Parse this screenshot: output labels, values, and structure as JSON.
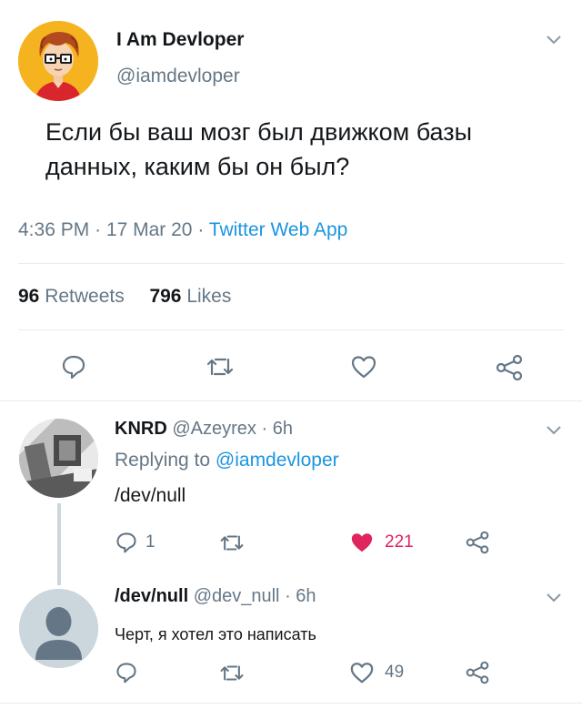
{
  "tweet": {
    "author_name": "I Am Devloper",
    "author_handle": "@iamdevloper",
    "text_line1": "Если бы ваш мозг был движком базы",
    "text_line2": "данных, каким бы он был?",
    "time": "4:36 PM",
    "dot1": "·",
    "date": "17 Mar 20",
    "dot2": "·",
    "source": "Twitter Web App",
    "retweets_count": "96",
    "retweets_label": "Retweets",
    "likes_count": "796",
    "likes_label": "Likes"
  },
  "reply1": {
    "name": "KNRD",
    "handle": "@Azeyrex",
    "dot": "·",
    "time": "6h",
    "replying_prefix": "Replying to",
    "replying_to": "@iamdevloper",
    "text": "/dev/null",
    "reply_count": "1",
    "like_count": "221",
    "liked": true
  },
  "reply2": {
    "name": "/dev/null",
    "handle": "@dev_null",
    "dot": "·",
    "time": "6h",
    "text": "Черт, я хотел это написать",
    "like_count": "49"
  },
  "colors": {
    "text": "#14171a",
    "muted": "#657786",
    "link": "#1b95e0",
    "like_red": "#e0245e",
    "avatar_bg": "#f5b41f",
    "divider": "#e6ecf0"
  },
  "icons": [
    "chevron-down-icon",
    "reply-icon",
    "retweet-icon",
    "like-icon",
    "share-icon"
  ]
}
